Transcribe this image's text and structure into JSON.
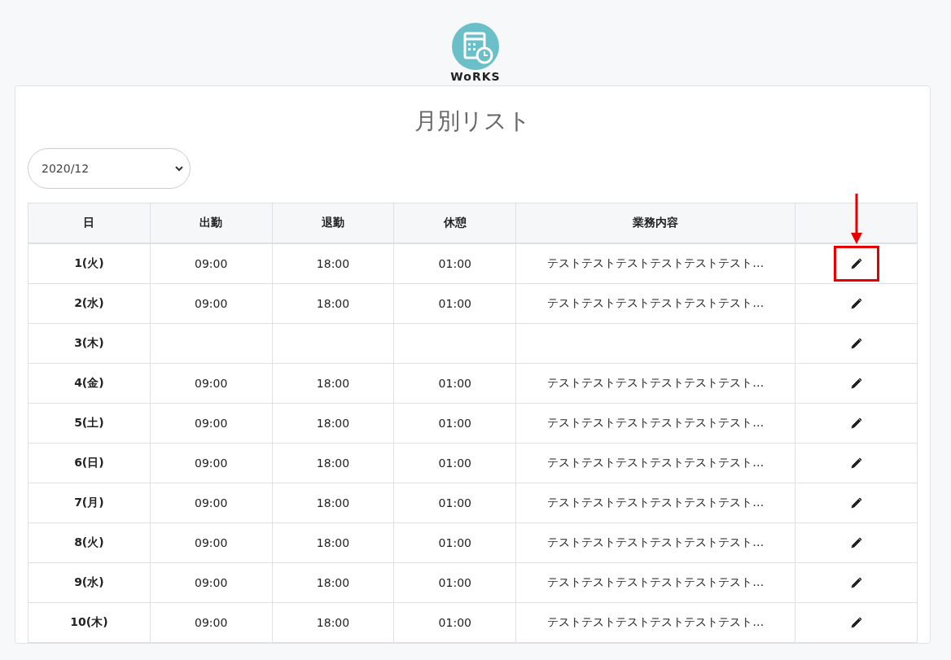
{
  "logo": {
    "text": "WoRKS"
  },
  "page_title": "月別リスト",
  "month_select": {
    "value": "2020/12"
  },
  "table": {
    "columns": [
      "日",
      "出勤",
      "退勤",
      "休憩",
      "業務内容",
      ""
    ],
    "rows": [
      {
        "day": "1(火)",
        "start": "09:00",
        "end": "18:00",
        "break": "01:00",
        "work": "テストテストテストテストテストテスト…",
        "highlighted": true
      },
      {
        "day": "2(水)",
        "start": "09:00",
        "end": "18:00",
        "break": "01:00",
        "work": "テストテストテストテストテストテスト…",
        "highlighted": false
      },
      {
        "day": "3(木)",
        "start": "",
        "end": "",
        "break": "",
        "work": "",
        "highlighted": false
      },
      {
        "day": "4(金)",
        "start": "09:00",
        "end": "18:00",
        "break": "01:00",
        "work": "テストテストテストテストテストテスト…",
        "highlighted": false
      },
      {
        "day": "5(土)",
        "start": "09:00",
        "end": "18:00",
        "break": "01:00",
        "work": "テストテストテストテストテストテスト…",
        "highlighted": false
      },
      {
        "day": "6(日)",
        "start": "09:00",
        "end": "18:00",
        "break": "01:00",
        "work": "テストテストテストテストテストテスト…",
        "highlighted": false
      },
      {
        "day": "7(月)",
        "start": "09:00",
        "end": "18:00",
        "break": "01:00",
        "work": "テストテストテストテストテストテスト…",
        "highlighted": false
      },
      {
        "day": "8(火)",
        "start": "09:00",
        "end": "18:00",
        "break": "01:00",
        "work": "テストテストテストテストテストテスト…",
        "highlighted": false
      },
      {
        "day": "9(水)",
        "start": "09:00",
        "end": "18:00",
        "break": "01:00",
        "work": "テストテストテストテストテストテスト…",
        "highlighted": false
      },
      {
        "day": "10(木)",
        "start": "09:00",
        "end": "18:00",
        "break": "01:00",
        "work": "テストテストテストテストテストテスト…",
        "highlighted": false
      }
    ]
  }
}
